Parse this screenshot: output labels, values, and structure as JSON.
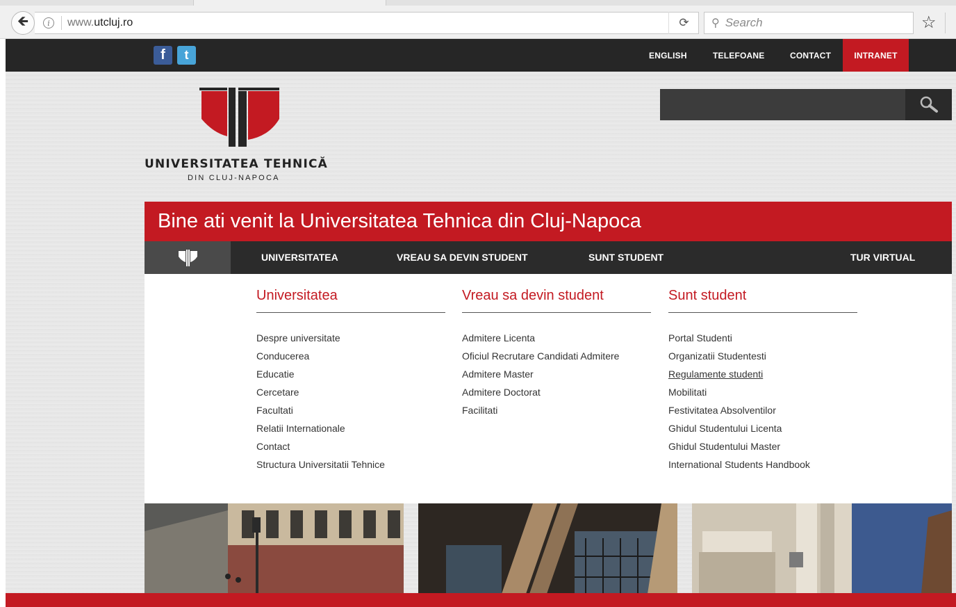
{
  "browser": {
    "url_prefix": "www.",
    "url_domain": "utcluj.ro",
    "search_placeholder": "Search"
  },
  "topbar": {
    "social": [
      "f",
      "t"
    ],
    "links": [
      "ENGLISH",
      "TELEFOANE",
      "CONTACT"
    ],
    "intranet": "INTRANET",
    "intranet_color": "#c31a22"
  },
  "logo": {
    "name": "UNIVERSITATEA TEHNICĂ",
    "subname": "DIN CLUJ-NAPOCA"
  },
  "welcome": "Bine ati venit la Universitatea Tehnica din Cluj-Napoca",
  "nav": {
    "items": [
      "UNIVERSITATEA",
      "VREAU SA DEVIN STUDENT",
      "SUNT STUDENT",
      "TUR VIRTUAL"
    ]
  },
  "dropdown": {
    "columns": [
      {
        "title": "Universitatea",
        "links": [
          "Despre universitate",
          "Conducerea",
          "Educatie",
          "Cercetare",
          "Facultati",
          "Relatii Internationale",
          "Contact",
          "Structura Universitatii Tehnice"
        ]
      },
      {
        "title": "Vreau sa devin student",
        "links": [
          "Admitere Licenta",
          "Oficiul Recrutare Candidati Admitere",
          "Admitere Master",
          "Admitere Doctorat",
          "Facilitati"
        ]
      },
      {
        "title": "Sunt student",
        "links": [
          "Portal Studenti",
          "Organizatii Studentesti",
          "Regulamente studenti",
          "Mobilitati",
          "Festivitatea Absolventilor",
          "Ghidul Studentului Licenta",
          "Ghidul Studentului Master",
          "International Students Handbook"
        ]
      }
    ]
  }
}
